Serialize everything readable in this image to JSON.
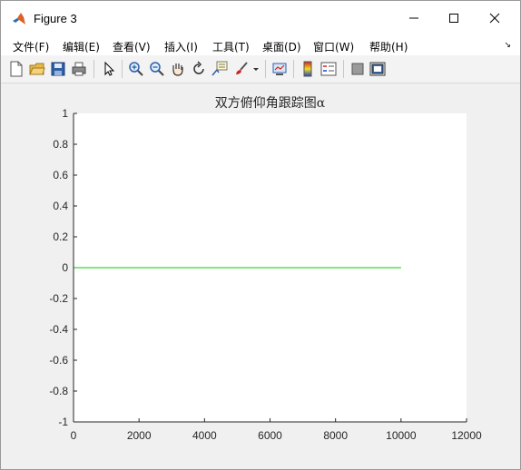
{
  "window": {
    "title": "Figure 3"
  },
  "menu": {
    "items": [
      "文件(F)",
      "编辑(E)",
      "查看(V)",
      "插入(I)",
      "工具(T)",
      "桌面(D)",
      "窗口(W)",
      "帮助(H)"
    ]
  },
  "toolbar": {
    "icons": [
      "new-figure-icon",
      "open-file-icon",
      "save-icon",
      "print-icon",
      "select-arrow-icon",
      "zoom-in-icon",
      "zoom-out-icon",
      "pan-hand-icon",
      "rotate-3d-icon",
      "data-cursor-icon",
      "brush-icon",
      "brush-dropdown-icon",
      "link-plot-icon",
      "colorbar-icon",
      "legend-icon",
      "hide-plot-tools-icon",
      "show-plot-tools-icon"
    ]
  },
  "chart_data": {
    "type": "line",
    "title": "双方俯仰角跟踪图α",
    "xlabel": "",
    "ylabel": "",
    "xlim": [
      0,
      12000
    ],
    "ylim": [
      -1,
      1
    ],
    "xticks": [
      0,
      2000,
      4000,
      6000,
      8000,
      10000,
      12000
    ],
    "xtick_labels": [
      "0",
      "2000",
      "4000",
      "6000",
      "8000",
      "10000",
      "12000"
    ],
    "yticks": [
      -1,
      -0.8,
      -0.6,
      -0.4,
      -0.2,
      0,
      0.2,
      0.4,
      0.6,
      0.8,
      1
    ],
    "ytick_labels": [
      "-1",
      "-0.8",
      "-0.6",
      "-0.4",
      "-0.2",
      "0",
      "0.2",
      "0.4",
      "0.6",
      "0.8",
      "1"
    ],
    "grid": false,
    "series": [
      {
        "color": "#00cc00",
        "x": [
          0,
          10000
        ],
        "y": [
          0,
          0
        ]
      }
    ]
  }
}
